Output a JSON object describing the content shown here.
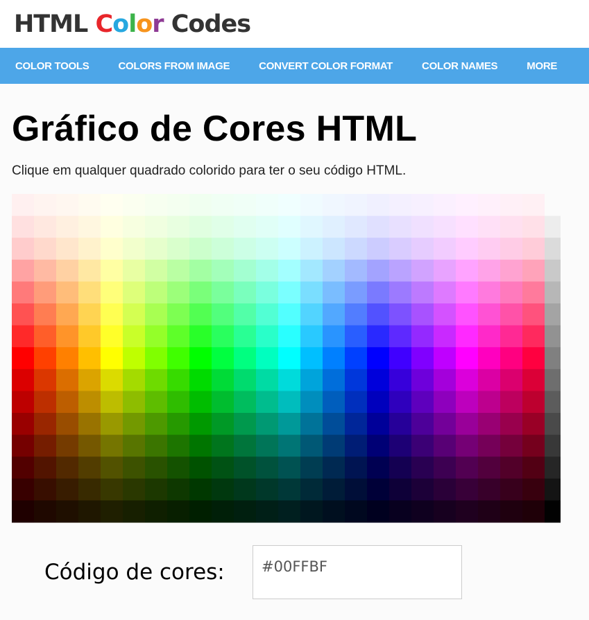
{
  "logo": {
    "parts": [
      {
        "text": "HTML ",
        "color": "#333333"
      },
      {
        "text": "C",
        "color": "#e8262b"
      },
      {
        "text": "o",
        "color": "#27a8e0"
      },
      {
        "text": "l",
        "color": "#3cb34a"
      },
      {
        "text": "o",
        "color": "#f7941d"
      },
      {
        "text": "r",
        "color": "#8e3a94"
      },
      {
        "text": " Codes",
        "color": "#333333"
      }
    ]
  },
  "nav": {
    "items": [
      "COLOR TOOLS",
      "COLORS FROM IMAGE",
      "CONVERT COLOR FORMAT",
      "COLOR NAMES",
      "MORE"
    ]
  },
  "page": {
    "title": "Gráfico de Cores HTML",
    "subtitle": "Clique em qualquer quadrado colorido para ter o seu código HTML."
  },
  "color_chart": {
    "hue_columns": 24,
    "hue_step_degrees": 15,
    "grayscale_column": true
  },
  "code_field": {
    "label": "Código de cores:",
    "value": "#00FFBF"
  }
}
